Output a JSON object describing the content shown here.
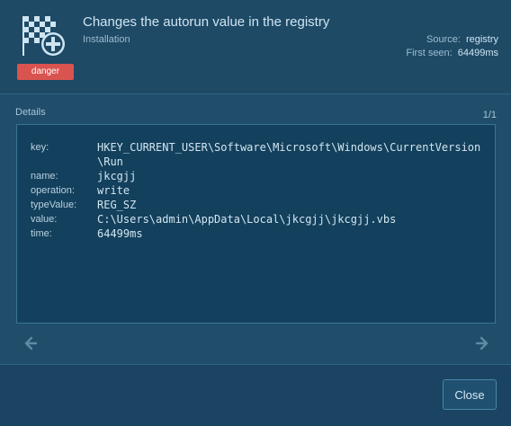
{
  "header": {
    "title": "Changes the autorun value in the registry",
    "subtitle": "Installation",
    "badge": "danger",
    "source_label": "Source:",
    "source_value": "registry",
    "first_seen_label": "First seen:",
    "first_seen_value": "64499ms"
  },
  "details": {
    "label": "Details",
    "pager": "1/1",
    "rows": [
      {
        "key": "key:",
        "value": "HKEY_CURRENT_USER\\Software\\Microsoft\\Windows\\CurrentVersion\\Run"
      },
      {
        "key": "name:",
        "value": "jkcgjj"
      },
      {
        "key": "operation:",
        "value": "write"
      },
      {
        "key": "typeValue:",
        "value": "REG_SZ"
      },
      {
        "key": "value:",
        "value": "C:\\Users\\admin\\AppData\\Local\\jkcgjj\\jkcgjj.vbs"
      },
      {
        "key": "time:",
        "value": "64499ms"
      }
    ]
  },
  "footer": {
    "close_label": "Close"
  },
  "colors": {
    "danger": "#d9534f",
    "background": "#1f4d6a",
    "details_bg": "#13405c"
  },
  "icons": {
    "header": "checkered-flag-add-icon",
    "prev": "arrow-left-icon",
    "next": "arrow-right-icon"
  }
}
